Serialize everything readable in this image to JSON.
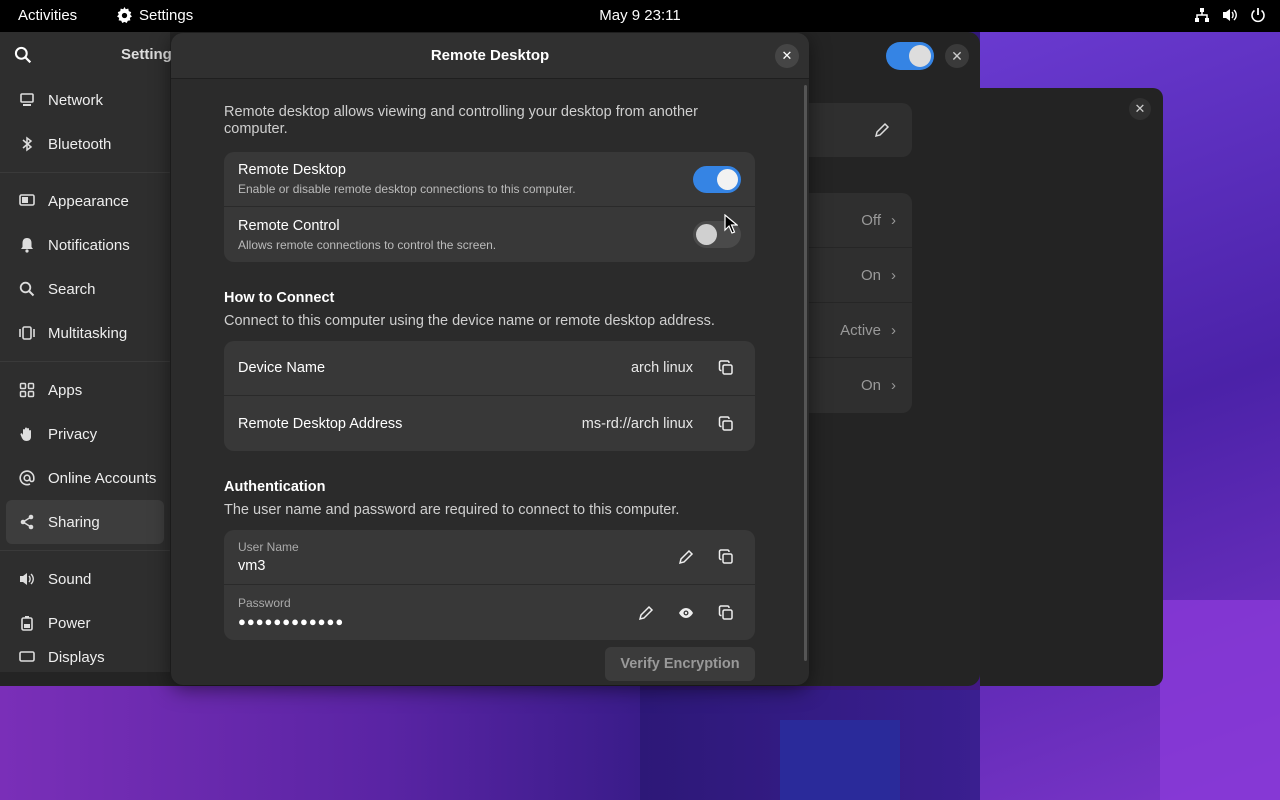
{
  "topbar": {
    "activities": "Activities",
    "app_name": "Settings",
    "clock": "May 9  23:11"
  },
  "settings": {
    "sidebar_title": "Setting",
    "items": [
      {
        "label": "Network",
        "icon": "network-icon"
      },
      {
        "label": "Bluetooth",
        "icon": "bluetooth-icon"
      },
      {
        "label": "Appearance",
        "icon": "appearance-icon"
      },
      {
        "label": "Notifications",
        "icon": "bell-icon"
      },
      {
        "label": "Search",
        "icon": "search-icon"
      },
      {
        "label": "Multitasking",
        "icon": "multitasking-icon"
      },
      {
        "label": "Apps",
        "icon": "apps-icon"
      },
      {
        "label": "Privacy",
        "icon": "hand-icon"
      },
      {
        "label": "Online Accounts",
        "icon": "at-icon"
      },
      {
        "label": "Sharing",
        "icon": "share-icon"
      },
      {
        "label": "Sound",
        "icon": "speaker-icon"
      },
      {
        "label": "Power",
        "icon": "battery-icon"
      },
      {
        "label": "Displays",
        "icon": "display-icon"
      }
    ],
    "back_rows": [
      "Off",
      "On",
      "Active",
      "On"
    ]
  },
  "dialog": {
    "title": "Remote Desktop",
    "intro": "Remote desktop allows viewing and controlling your desktop from another computer.",
    "remote_desktop": {
      "title": "Remote Desktop",
      "subtitle": "Enable or disable remote desktop connections to this computer.",
      "enabled": true
    },
    "remote_control": {
      "title": "Remote Control",
      "subtitle": "Allows remote connections to control the screen.",
      "enabled": false
    },
    "how_to_connect": {
      "heading": "How to Connect",
      "description": "Connect to this computer using the device name or remote desktop address.",
      "device_name_label": "Device Name",
      "device_name_value": "arch linux",
      "address_label": "Remote Desktop Address",
      "address_value": "ms-rd://arch linux"
    },
    "authentication": {
      "heading": "Authentication",
      "description": "The user name and password are required to connect to this computer.",
      "username_label": "User Name",
      "username_value": "vm3",
      "password_label": "Password",
      "password_value": "●●●●●●●●●●●●"
    },
    "verify_button": "Verify Encryption"
  },
  "colors": {
    "accent": "#3584e4",
    "dialog_bg": "#2b2b2b",
    "card_bg": "#383838"
  }
}
